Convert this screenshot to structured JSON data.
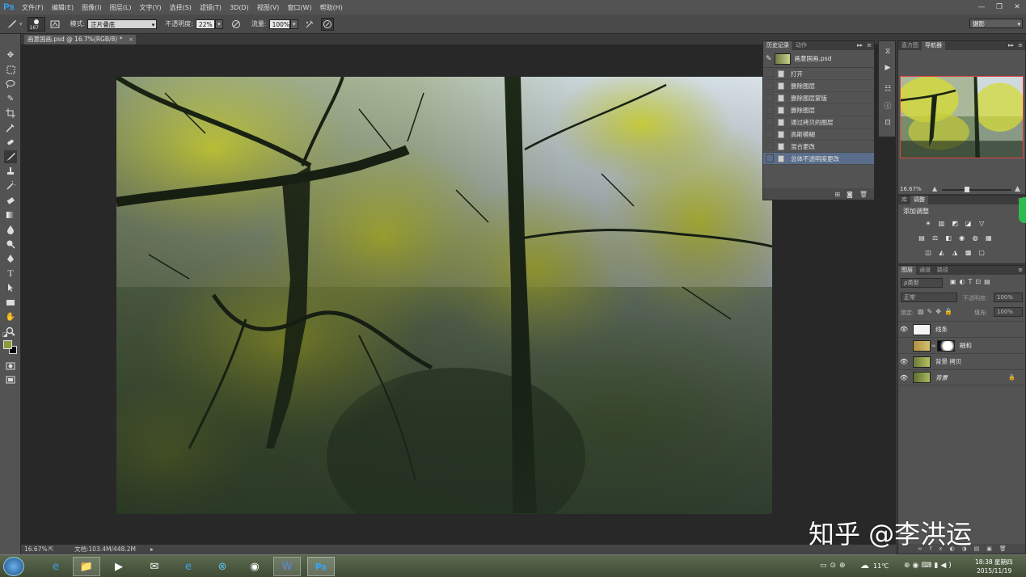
{
  "app": {
    "logo": "Ps"
  },
  "menu": [
    "文件(F)",
    "编辑(E)",
    "图像(I)",
    "图层(L)",
    "文字(Y)",
    "选择(S)",
    "滤镜(T)",
    "3D(D)",
    "视图(V)",
    "窗口(W)",
    "帮助(H)"
  ],
  "window_controls": [
    "—",
    "❐",
    "✕"
  ],
  "options": {
    "brush_size": "167",
    "mode_label": "模式:",
    "mode_value": "正片叠底",
    "opacity_label": "不透明度:",
    "opacity_value": "22%",
    "flow_label": "流量:",
    "flow_value": "100%",
    "workspace": "摄影"
  },
  "document": {
    "tab_title": "画意国画.psd @ 16.7%(RGB/8) *",
    "tab_close": "×",
    "zoom": "16.67%",
    "doc_info": "文档:103.4M/448.2M"
  },
  "history": {
    "tabs": [
      "历史记录",
      "动作"
    ],
    "snapshot_name": "画意国画.psd",
    "items": [
      "打开",
      "删除图层",
      "删除图层蒙版",
      "删除图层",
      "通过拷贝的图层",
      "高斯模糊",
      "混合更改",
      "总体不透明度更改"
    ],
    "selected_index": 7
  },
  "navigator": {
    "tabs": [
      "直方图",
      "导航器"
    ],
    "zoom": "16.67%"
  },
  "adjustments": {
    "tabs": [
      "库",
      "调整"
    ],
    "title": "添加调整",
    "row1": [
      "☀",
      "▥",
      "◩",
      "◪",
      "▽"
    ],
    "row2": [
      "▤",
      "⚖",
      "◧",
      "◉",
      "◍",
      "▦"
    ],
    "row3": [
      "◫",
      "◭",
      "◮",
      "▩",
      "▢"
    ]
  },
  "layers": {
    "tabs": [
      "图层",
      "通道",
      "路径"
    ],
    "filter": "ρ类型",
    "blend": "正常",
    "opacity_label": "不透明度:",
    "opacity_value": "100%",
    "lock_label": "锁定:",
    "fill_label": "填充:",
    "fill_value": "100%",
    "items": [
      {
        "name": "线条",
        "visible": true
      },
      {
        "name": "融和",
        "visible": false
      },
      {
        "name": "背景 拷贝",
        "visible": true
      },
      {
        "name": "背景",
        "visible": true,
        "locked": true
      }
    ]
  },
  "taskbar": {
    "weather": "11℃",
    "time": "18:38 星期四",
    "date": "2015/11/19"
  },
  "watermark": "知乎 @李洪运",
  "colors": {
    "accent_ps": "#31a8ff",
    "history_selected": "#5a6d8a",
    "fg_swatch": "#8a9b3c"
  }
}
